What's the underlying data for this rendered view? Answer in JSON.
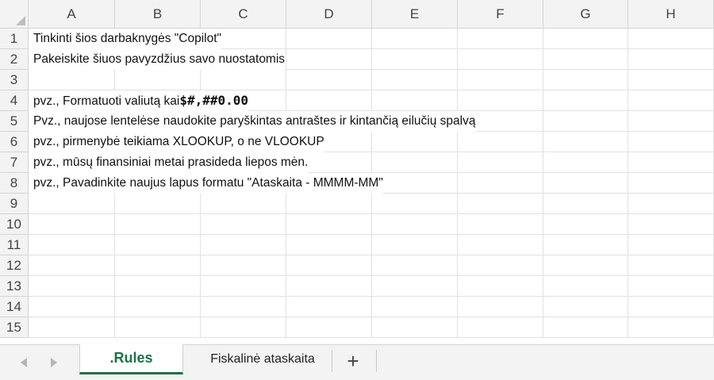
{
  "sheet": {
    "columns": [
      "A",
      "B",
      "C",
      "D",
      "E",
      "F",
      "G",
      "H"
    ],
    "rows": [
      "1",
      "2",
      "3",
      "4",
      "5",
      "6",
      "7",
      "8",
      "9",
      "10",
      "11",
      "12",
      "13",
      "14",
      "15"
    ],
    "cells": {
      "r1": "Tinkinti šios darbaknygės \"Copilot\"",
      "r2": "Pakeiskite šiuos pavyzdžius savo nuostatomis",
      "r4_prefix": "pvz., Formatuoti valiutą kai",
      "r4_format": "$#,##0.00",
      "r5": "Pvz., naujose lentelėse naudokite paryškintas antraštes ir kintančią eilučių spalvą",
      "r6": "pvz., pirmenybė teikiama XLOOKUP, o ne VLOOKUP",
      "r7": "pvz., mūsų finansiniai metai prasideda liepos mėn.",
      "r8": "pvz., Pavadinkite naujus lapus formatu \"Ataskaita - MMMM-MM\""
    }
  },
  "tabs": {
    "prev_icon": "chevron-left-icon",
    "next_icon": "chevron-right-icon",
    "items": [
      {
        "label": ".Rules",
        "active": true
      },
      {
        "label": "Fiskalinė ataskaita",
        "active": false
      }
    ],
    "add_label": "+"
  },
  "colors": {
    "accent": "#1e7145",
    "header_bg": "#f3f3f3",
    "gridline": "#e1e1e1"
  }
}
